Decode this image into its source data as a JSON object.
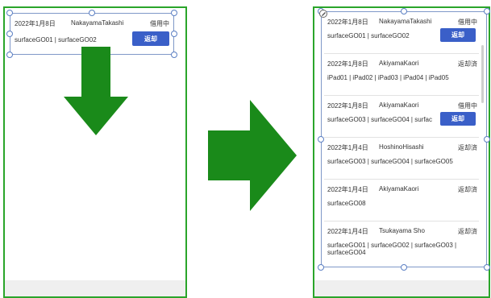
{
  "left_panel": {
    "row": {
      "date": "2022年1月8日",
      "name": "NakayamaTakashi",
      "status": "借用中",
      "items": "surfaceGO01 | surfaceGO02",
      "button_label": "返却"
    }
  },
  "right_panel": {
    "rows": [
      {
        "date": "2022年1月8日",
        "name": "NakayamaTakashi",
        "status": "借用中",
        "items": "surfaceGO01 | surfaceGO02",
        "button_label": "返却"
      },
      {
        "date": "2022年1月8日",
        "name": "AkiyamaKaori",
        "status": "返却済",
        "items": "iPad01 | iPad02 | iPad03 | iPad04 | iPad05"
      },
      {
        "date": "2022年1月8日",
        "name": "AkiyamaKaori",
        "status": "借用中",
        "items": "surfaceGO03 | surfaceGO04 | surfac",
        "button_label": "返却"
      },
      {
        "date": "2022年1月4日",
        "name": "HoshinoHisashi",
        "status": "返却済",
        "items": "surfaceGO03 | surfaceGO04 | surfaceGO05"
      },
      {
        "date": "2022年1月4日",
        "name": "AkiyamaKaori",
        "status": "返却済",
        "items": "surfaceGO08"
      },
      {
        "date": "2022年1月4日",
        "name": "Tsukayama Sho",
        "status": "返却済",
        "items": "surfaceGO01 | surfaceGO02 | surfaceGO03 | surfaceGO04"
      }
    ]
  },
  "icons": {
    "arrow_down": "arrow-down-icon",
    "arrow_right": "arrow-right-icon",
    "edit": "pencil-icon"
  },
  "colors": {
    "frame_green": "#2aa52a",
    "arrow_green": "#1a8a1a",
    "button_blue": "#3a5fc8",
    "selection_blue": "#5b7fc3"
  }
}
